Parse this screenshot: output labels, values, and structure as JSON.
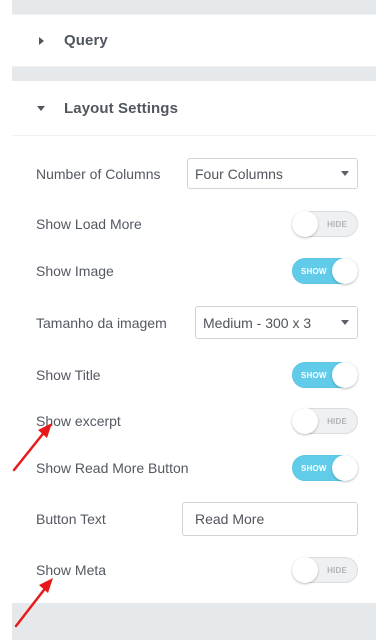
{
  "sections": {
    "query": {
      "title": "Query"
    },
    "layout": {
      "title": "Layout Settings"
    }
  },
  "controls": {
    "columns": {
      "label": "Number of Columns",
      "value": "Four Columns"
    },
    "load_more": {
      "label": "Show Load More",
      "state": "HIDE"
    },
    "image": {
      "label": "Show Image",
      "state": "SHOW"
    },
    "image_size": {
      "label": "Tamanho da imagem",
      "value": "Medium - 300 x 3"
    },
    "title": {
      "label": "Show Title",
      "state": "SHOW"
    },
    "excerpt": {
      "label": "Show excerpt",
      "state": "HIDE"
    },
    "read_more_button": {
      "label": "Show Read More Button",
      "state": "SHOW"
    },
    "button_text": {
      "label": "Button Text",
      "value": "Read More"
    },
    "meta": {
      "label": "Show Meta",
      "state": "HIDE"
    }
  },
  "colors": {
    "toggle_on": "#61ccea",
    "toggle_off": "#eef0f2",
    "panel_bg": "#e6e9ec",
    "annotation_arrow": "#e8191b"
  },
  "icons": {
    "collapsed": "caret-right-icon",
    "expanded": "caret-down-icon",
    "select": "chevron-down-icon"
  }
}
